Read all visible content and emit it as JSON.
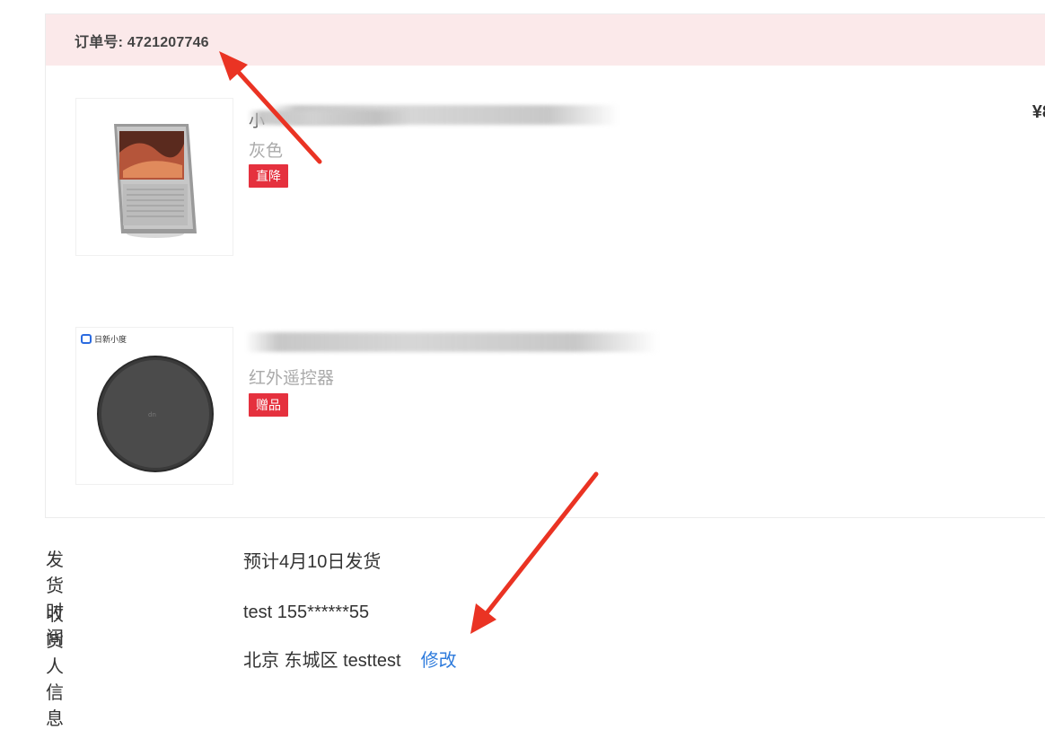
{
  "order": {
    "label": "订单号:",
    "number": "4721207746",
    "price": "¥8"
  },
  "items": [
    {
      "title": "小",
      "spec": "灰色",
      "tag": "直降",
      "image_icon": "smart-display-image"
    },
    {
      "title": "",
      "spec": "红外遥控器",
      "tag": "赠品",
      "image_badge": "日新小度",
      "image_icon": "infrared-remote-image"
    }
  ],
  "shipping": {
    "label": "发货时间",
    "value": "预计4月10日发货"
  },
  "receiver": {
    "label": "收货人信息",
    "name_phone": "test 155******55",
    "address": "北京 东城区 testtest",
    "edit_label": "修改"
  },
  "colors": {
    "header_bg": "#fbe9ea",
    "tag_red": "#e5313e",
    "link_blue": "#2e7bdc",
    "arrow_red": "#ea3323"
  }
}
